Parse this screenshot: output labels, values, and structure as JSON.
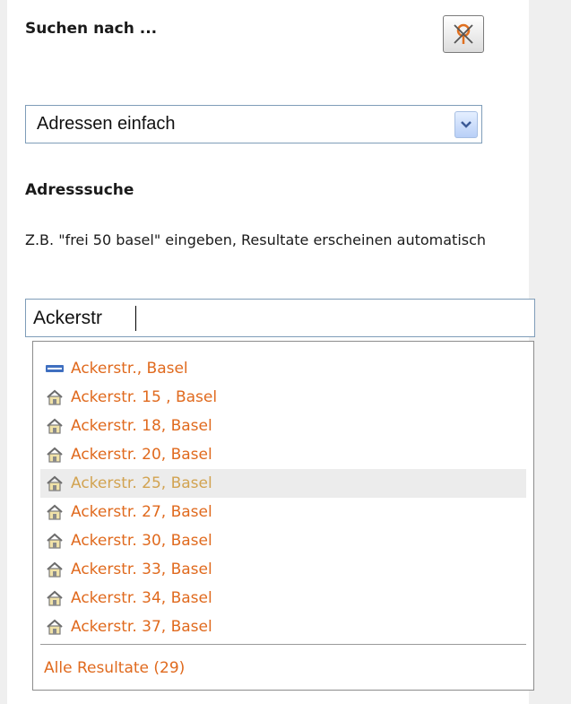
{
  "header": {
    "title": "Suchen nach ...",
    "close_icon": "no-location-icon"
  },
  "search_type": {
    "selected": "Adressen einfach"
  },
  "section": {
    "title": "Adresssuche",
    "hint": "Z.B. \"frei 50 basel\" eingeben, Resultate erscheinen automatisch"
  },
  "search": {
    "value": "Ackerstr"
  },
  "results": {
    "items": [
      {
        "label": "Ackerstr., Basel",
        "icon": "street-icon"
      },
      {
        "label": "Ackerstr. 15 , Basel",
        "icon": "house-icon"
      },
      {
        "label": "Ackerstr. 18, Basel",
        "icon": "house-icon"
      },
      {
        "label": "Ackerstr. 20, Basel",
        "icon": "house-icon"
      },
      {
        "label": "Ackerstr. 25, Basel",
        "icon": "house-icon",
        "highlighted": true
      },
      {
        "label": "Ackerstr. 27, Basel",
        "icon": "house-icon"
      },
      {
        "label": "Ackerstr. 30, Basel",
        "icon": "house-icon"
      },
      {
        "label": "Ackerstr. 33, Basel",
        "icon": "house-icon"
      },
      {
        "label": "Ackerstr. 34, Basel",
        "icon": "house-icon"
      },
      {
        "label": "Ackerstr. 37, Basel",
        "icon": "house-icon"
      }
    ],
    "all_label": "Alle Resultate (29)"
  },
  "colors": {
    "link": "#e06a1e",
    "link_highlighted": "#d2a351",
    "highlight_bg": "#ececec",
    "input_border": "#7f9db9"
  }
}
